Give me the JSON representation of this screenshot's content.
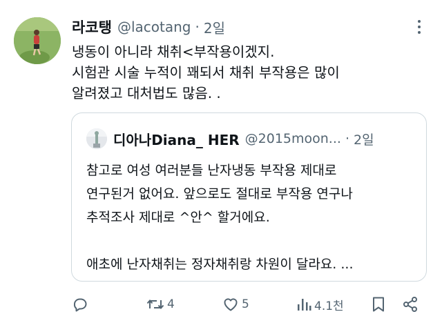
{
  "tweet": {
    "display_name": "라코탱",
    "handle": "@lacotang",
    "separator": "·",
    "time": "2일",
    "lines": [
      "냉동이 아니라 채취<부작용이겠지.",
      "시험관 시술 누적이 꽤되서 채취 부작용은 많이",
      "알려졌고 대처법도 많음. ."
    ]
  },
  "quote": {
    "display_name": "디아나Diana_ HER",
    "handle": "@2015moon...",
    "separator": "·",
    "time": "2일",
    "lines": [
      "참고로 여성 여러분들 난자냉동 부작용 제대로",
      "연구된거 없어요. 앞으로도 절대로 부작용 연구나",
      "추적조사 제대로 ^안^ 할거에요.",
      "",
      "애초에 난자채취는 정자채취랑 차원이 달라요. ..."
    ]
  },
  "actions": {
    "reply_icon": "reply-icon",
    "retweet_icon": "retweet-icon",
    "retweet_count": "4",
    "like_icon": "heart-icon",
    "like_count": "5",
    "views_icon": "views-icon",
    "views_count": "4.1천",
    "bookmark_icon": "bookmark-icon",
    "share_icon": "share-icon"
  },
  "colors": {
    "text_primary": "#0f1419",
    "text_secondary": "#536471",
    "border": "#cfd9de",
    "background": "#ffffff"
  }
}
